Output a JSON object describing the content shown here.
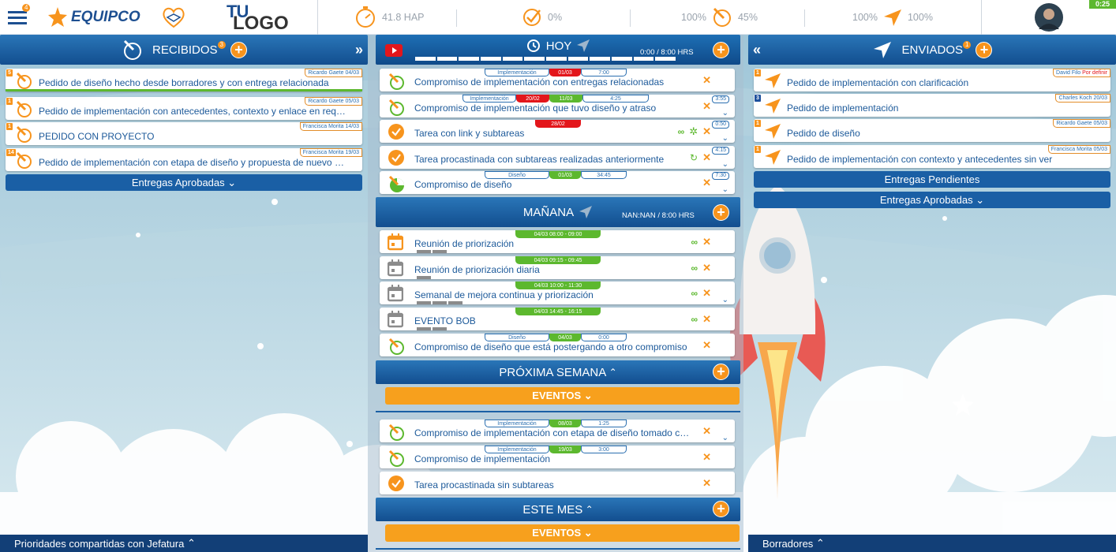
{
  "topbar": {
    "menu_badge": "4",
    "brand": "EQUIPCO",
    "logo_tu": "TU",
    "logo_logo": "LOGO",
    "hap": "41.8 HAP",
    "pct1": "0%",
    "pct2a": "100%",
    "pct2b": "45%",
    "pct3a": "100%",
    "pct3b": "100%",
    "timer": "0:25"
  },
  "recibidos": {
    "title": "RECIBIDOS",
    "badge": "3",
    "cards": [
      {
        "num": "5",
        "tag_name": "Ricardo Gaete",
        "tag_date": "04/03",
        "title": "Pedido de diseño hecho desde borradores y con entrega relacionada"
      },
      {
        "num": "1",
        "tag_name": "Ricardo Gaete",
        "tag_date": "05/03",
        "title": "Pedido de implementación con antecedentes, contexto y enlace en requisitos"
      },
      {
        "num": "1",
        "tag_name": "Francisca Morita",
        "tag_date": "14/03",
        "title": "PEDIDO CON PROYECTO"
      },
      {
        "num": "14",
        "tag_name": "Francisca Morita",
        "tag_date": "19/03",
        "title": "Pedido de implementación con etapa de diseño y propuesta de nuevo plazo"
      }
    ],
    "entregas_aprobadas": "Entregas Aprobadas",
    "footer": "Prioridades compartidas con Jefatura"
  },
  "hoy": {
    "title": "HOY",
    "hours": "0:00 / 8:00 HRS",
    "cards": [
      {
        "pill_type": "Implementación",
        "pill_date": "01/03",
        "pill_time": "7:00",
        "title": "Compromiso de implementación con entregas relacionadas",
        "dur": ""
      },
      {
        "pill_type": "Implementación",
        "pill_date": "20/02",
        "pill_date2": "11/03",
        "pill_time": "4:25",
        "title": "Compromiso de implementación que tuvo diseño y atraso",
        "dur": "3:55"
      },
      {
        "pill_date": "28/02",
        "title": "Tarea con link y subtareas",
        "dur": "0:50"
      },
      {
        "title": "Tarea procastinada con subtareas realizadas anteriormente",
        "dur": "4:15"
      },
      {
        "pill_type": "Diseño",
        "pill_date": "01/03",
        "pill_time": "34:45",
        "title": "Compromiso de diseño",
        "dur": "7:30"
      }
    ]
  },
  "manana": {
    "title": "MAÑANA",
    "hours": "NAN:NAN / 8:00 HRS",
    "cards": [
      {
        "pill": "04/03    08:00 - 09:00",
        "title": "Reunión de priorización"
      },
      {
        "pill": "04/03    09:15 - 09:45",
        "title": "Reunión de priorización diaria"
      },
      {
        "pill": "04/03    10:00 - 11:30",
        "title": "Semanal de mejora continua y priorización"
      },
      {
        "pill": "04/03    14:45 - 16:15",
        "title": "EVENTO BOB"
      },
      {
        "pill_type": "Diseño",
        "pill_date": "04/03",
        "pill_time": "0:00",
        "title": "Compromiso de diseño que está postergando a otro compromiso"
      }
    ]
  },
  "proxima": {
    "title": "PRÓXIMA SEMANA",
    "eventos": "EVENTOS",
    "cards": [
      {
        "pill_type": "Implementación",
        "pill_date": "08/03",
        "pill_time": "1:25",
        "title": "Compromiso de implementación con etapa de diseño tomado con ex..."
      },
      {
        "pill_type": "Implementación",
        "pill_date": "19/03",
        "pill_time": "3:00",
        "title": "Compromiso de implementación"
      },
      {
        "title": "Tarea procastinada sin subtareas"
      }
    ]
  },
  "mes": {
    "title": "ESTE MES",
    "eventos": "EVENTOS"
  },
  "enviados": {
    "title": "ENVIADOS",
    "badge": "1",
    "cards": [
      {
        "num": "1",
        "tag_name": "David Filo",
        "tag_date": "Por definir",
        "title": "Pedido de implementación con clarificación"
      },
      {
        "num": "3",
        "tag_name": "Charles Koch",
        "tag_date": "20/03",
        "title": "Pedido de implementación"
      },
      {
        "num": "1",
        "tag_name": "Ricardo Gaete",
        "tag_date": "05/03",
        "title": "Pedido de diseño"
      },
      {
        "num": "1",
        "tag_name": "Francisca Morita",
        "tag_date": "05/03",
        "title": "Pedido de implementación con contexto y antecedentes sin ver"
      }
    ],
    "entregas_pendientes": "Entregas Pendientes",
    "entregas_aprobadas": "Entregas Aprobadas",
    "footer": "Borradores"
  },
  "colors": {
    "accent": "#f7941d",
    "blue": "#1a5fa5",
    "green": "#5cb82e",
    "red": "#e3161b"
  }
}
